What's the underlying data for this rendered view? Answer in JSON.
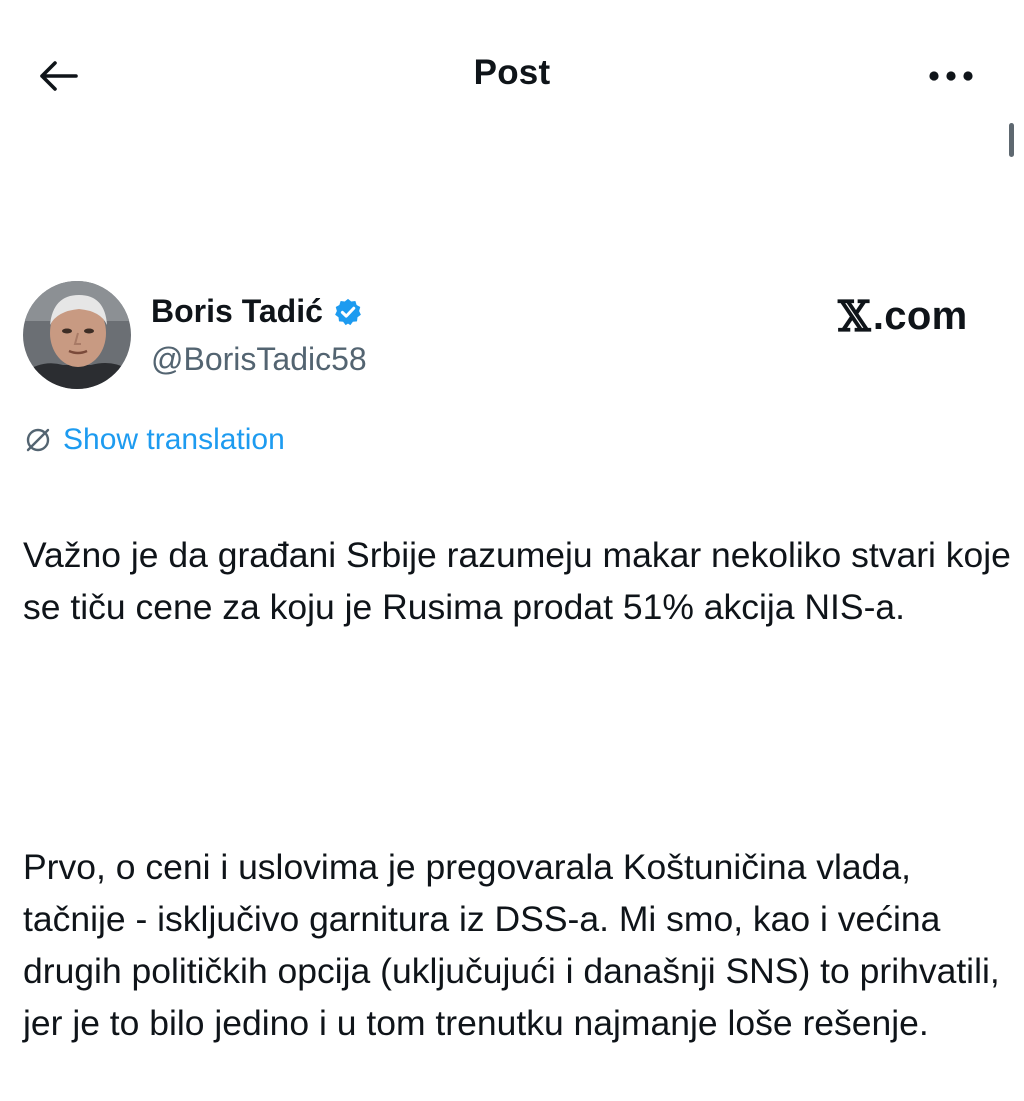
{
  "header": {
    "title": "Post",
    "back_icon": "arrow-left-icon",
    "more_icon": "more-horizontal-icon"
  },
  "author": {
    "name": "Boris Tadić",
    "handle": "@BorisTadic58",
    "verified": true,
    "verified_color": "#1d9bf0"
  },
  "brand": {
    "x_glyph": "𝕏",
    "suffix": ".com"
  },
  "translation": {
    "label": "Show translation",
    "icon": "globe-slash-icon",
    "color": "#1d9bf0"
  },
  "tweet": {
    "paragraphs": [
      "Važno je da građani Srbije razumeju makar nekoliko stvari koje se tiču cene za koju je Rusima prodat 51% akcija NIS-a.",
      "Prvo, o ceni i uslovima je pregovarala Koštuničina vlada, tačnije - isključivo garnitura iz DSS-a. Mi smo, kao i većina drugih političkih opcija (uključujući i današnji SNS) to prihvatili, jer je to bilo jedino i u tom trenutku najmanje  loše rešenje."
    ]
  }
}
